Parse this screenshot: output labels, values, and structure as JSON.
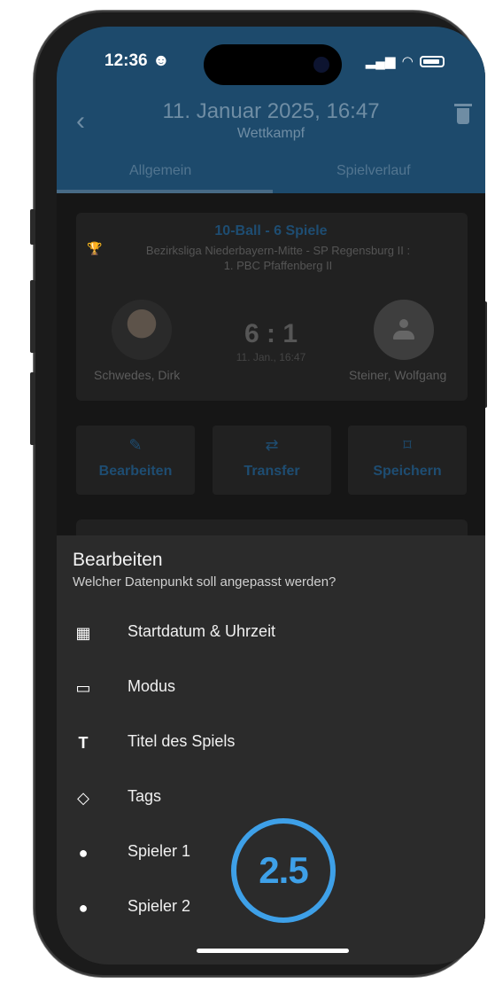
{
  "status": {
    "time": "12:36",
    "emoji": "☻"
  },
  "header": {
    "title": "11. Januar 2025, 16:47",
    "subtitle": "Wettkampf",
    "tabs": [
      {
        "label": "Allgemein"
      },
      {
        "label": "Spielverlauf"
      }
    ]
  },
  "match": {
    "title": "10-Ball - 6 Spiele",
    "league": "Bezirksliga Niederbayern-Mitte - SP Regensburg II :",
    "league2": "1. PBC Pfaffenberg II",
    "player1": "Schwedes, Dirk",
    "player2": "Steiner, Wolfgang",
    "score": "6 : 1",
    "time": "11. Jan., 16:47"
  },
  "actions": [
    {
      "label": "Bearbeiten",
      "icon": "pencil-icon"
    },
    {
      "label": "Transfer",
      "icon": "transfer-icon"
    },
    {
      "label": "Speichern",
      "icon": "bookmark-add-icon"
    }
  ],
  "sheet": {
    "title": "Bearbeiten",
    "subtitle": "Welcher Datenpunkt soll angepasst werden?",
    "items": [
      {
        "label": "Startdatum & Uhrzeit",
        "icon": "calendar-icon"
      },
      {
        "label": "Modus",
        "icon": "clipboard-icon"
      },
      {
        "label": "Titel des Spiels",
        "icon": "text-icon"
      },
      {
        "label": "Tags",
        "icon": "tag-icon"
      },
      {
        "label": "Spieler 1",
        "icon": "person-icon"
      },
      {
        "label": "Spieler 2",
        "icon": "person-icon"
      }
    ]
  },
  "badge": {
    "label": "2.5",
    "color": "#3ea0e8"
  },
  "colors": {
    "header": "#1d4a6c",
    "accent": "#1e4d72",
    "sheet": "#2b2b2b"
  }
}
